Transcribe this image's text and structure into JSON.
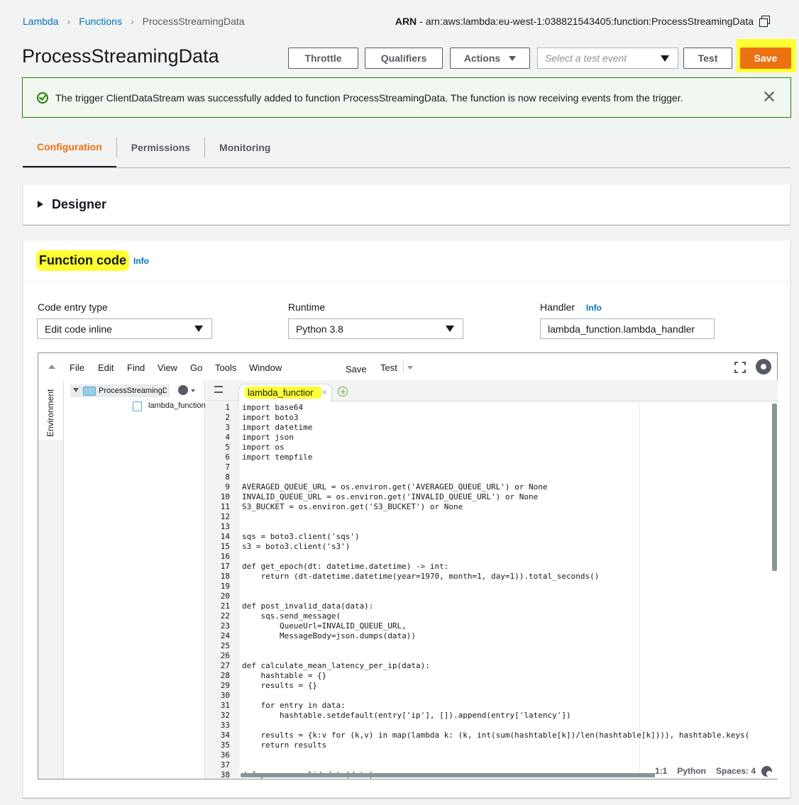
{
  "breadcrumb": {
    "root": "Lambda",
    "functions": "Functions",
    "current": "ProcessStreamingData"
  },
  "arn": {
    "label": "ARN",
    "value": "- arn:aws:lambda:eu-west-1:038821543405:function:ProcessStreamingData"
  },
  "title": "ProcessStreamingData",
  "toolbar": {
    "throttle": "Throttle",
    "qualifiers": "Qualifiers",
    "actions": "Actions",
    "test_event_placeholder": "Select a test event",
    "test": "Test",
    "save": "Save"
  },
  "alert": {
    "message": "The trigger ClientDataStream was successfully added to function ProcessStreamingData. The function is now receiving events from the trigger."
  },
  "tabs": [
    "Configuration",
    "Permissions",
    "Monitoring"
  ],
  "designer": {
    "title": "Designer"
  },
  "function_code": {
    "title": "Function code",
    "info": "Info",
    "code_entry_label": "Code entry type",
    "code_entry_value": "Edit code inline",
    "runtime_label": "Runtime",
    "runtime_value": "Python 3.8",
    "handler_label": "Handler",
    "handler_info": "Info",
    "handler_value": "lambda_function.lambda_handler"
  },
  "ide": {
    "menu": [
      "File",
      "Edit",
      "Find",
      "View",
      "Go",
      "Tools",
      "Window",
      "Save",
      "Test"
    ],
    "environment_label": "Environment",
    "folder_name": "ProcessStreamingDa",
    "file_name": "lambda_function.py",
    "tab_name": "lambda_functior",
    "status": {
      "position": "1:1",
      "language": "Python",
      "spaces": "Spaces: 4"
    },
    "code_lines": [
      "import base64",
      "import boto3",
      "import datetime",
      "import json",
      "import os",
      "import tempfile",
      "",
      "",
      "AVERAGED_QUEUE_URL = os.environ.get('AVERAGED_QUEUE_URL') or None",
      "INVALID_QUEUE_URL = os.environ.get('INVALID_QUEUE_URL') or None",
      "S3_BUCKET = os.environ.get('S3_BUCKET') or None",
      "",
      "",
      "sqs = boto3.client('sqs')",
      "s3 = boto3.client('s3')",
      "",
      "def get_epoch(dt: datetime.datetime) -> int:",
      "    return (dt-datetime.datetime(year=1970, month=1, day=1)).total_seconds()",
      "",
      "",
      "def post_invalid_data(data):",
      "    sqs.send_message(",
      "        QueueUrl=INVALID_QUEUE_URL,",
      "        MessageBody=json.dumps(data))",
      "",
      "",
      "def calculate_mean_latency_per_ip(data):",
      "    hashtable = {}",
      "    results = {}",
      "",
      "    for entry in data:",
      "        hashtable.setdefault(entry['ip'], []).append(entry['latency'])",
      "",
      "    results = {k:v for (k,v) in map(lambda k: (k, int(sum(hashtable[k])/len(hashtable[k]))), hashtable.keys(",
      "    return results",
      "",
      "",
      "def process_valid_data(data):"
    ]
  }
}
